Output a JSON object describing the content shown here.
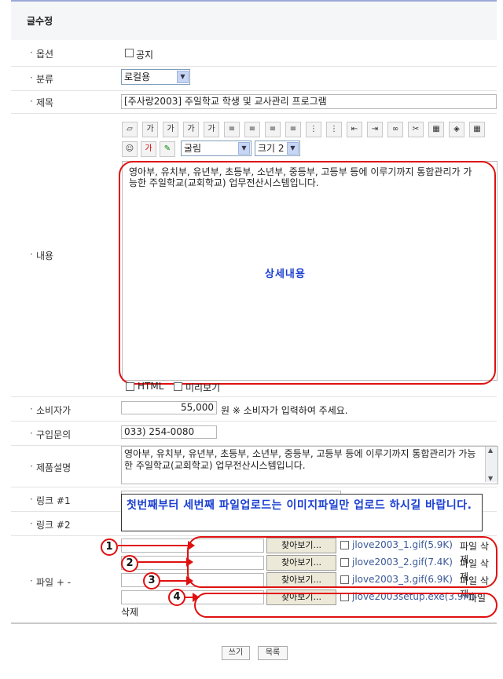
{
  "page_title": "글수정",
  "fields": {
    "option": {
      "label": "옵션",
      "notice_label": "공지"
    },
    "category": {
      "label": "분류",
      "value": "로컬용"
    },
    "subject": {
      "label": "제목",
      "value": "[주사랑2003] 주일학교 학생 및 교사관리 프로그램"
    },
    "content": {
      "label": "내용",
      "font_value": "굴림",
      "size_value": "크기 2",
      "text": "영아부, 유치부, 유년부, 초등부, 소년부, 중등부, 고등부 등에 이루기까지 통합관리가 가능한 주일학교(교회학교) 업무전산시스템입니다.",
      "annotation": "상세내용",
      "html_label": "HTML",
      "preview_label": "미리보기",
      "toolbar_icons": [
        "eraser-icon",
        "bold-icon",
        "italic-icon",
        "underline-icon",
        "strike-icon",
        "align-left-icon",
        "align-center-icon",
        "align-right-icon",
        "align-justify-icon",
        "ordered-list-icon",
        "unordered-list-icon",
        "outdent-icon",
        "indent-icon",
        "link-icon",
        "unlink-icon",
        "image-icon",
        "media-icon",
        "table-icon"
      ],
      "toolbar_glyphs": [
        "▱",
        "가",
        "가",
        "가",
        "가",
        "≡",
        "≡",
        "≡",
        "≡",
        "⋮",
        "⋮",
        "⇤",
        "⇥",
        "∞",
        "✂",
        "▦",
        "◈",
        "▦"
      ]
    },
    "price": {
      "label": "소비자가",
      "value": "55,000",
      "unit_note": "원 ※ 소비자가 입력하여 주세요."
    },
    "inquiry": {
      "label": "구입문의",
      "value": "033) 254-0080"
    },
    "description": {
      "label": "제품설명",
      "text": "영아부, 유치부, 유년부, 초등부, 소년부, 중등부, 고등부 등에 이루기까지 통합관리가 가능한 주일학교(교회학교) 업무전산시스템입니다."
    },
    "link1": {
      "label": "링크 #1"
    },
    "link2": {
      "label": "링크 #2"
    },
    "notice_box": "첫번째부터 세번째 파일업로드는 이미지파일만 업로드 하시길 바랍니다.",
    "files": {
      "label": "파일 + -",
      "browse_label": "찾아보기...",
      "items": [
        {
          "num": "1",
          "name": "jlove2003_1.gif(5.9K)",
          "delete": "파일 삭제"
        },
        {
          "num": "2",
          "name": "jlove2003_2.gif(7.4K)",
          "delete": "파일 삭제"
        },
        {
          "num": "3",
          "name": "jlove2003_3.gif(6.9K)",
          "delete": "파일 삭제"
        },
        {
          "num": "4",
          "name": "jlove2003setup.exe(3.9M)",
          "delete": "파일",
          "delete_wrap": "삭제"
        }
      ]
    }
  },
  "footer": {
    "write_label": "쓰기",
    "list_label": "목록"
  },
  "colors": {
    "annotation": "#e01010",
    "link_blue": "#1a3fd1"
  }
}
